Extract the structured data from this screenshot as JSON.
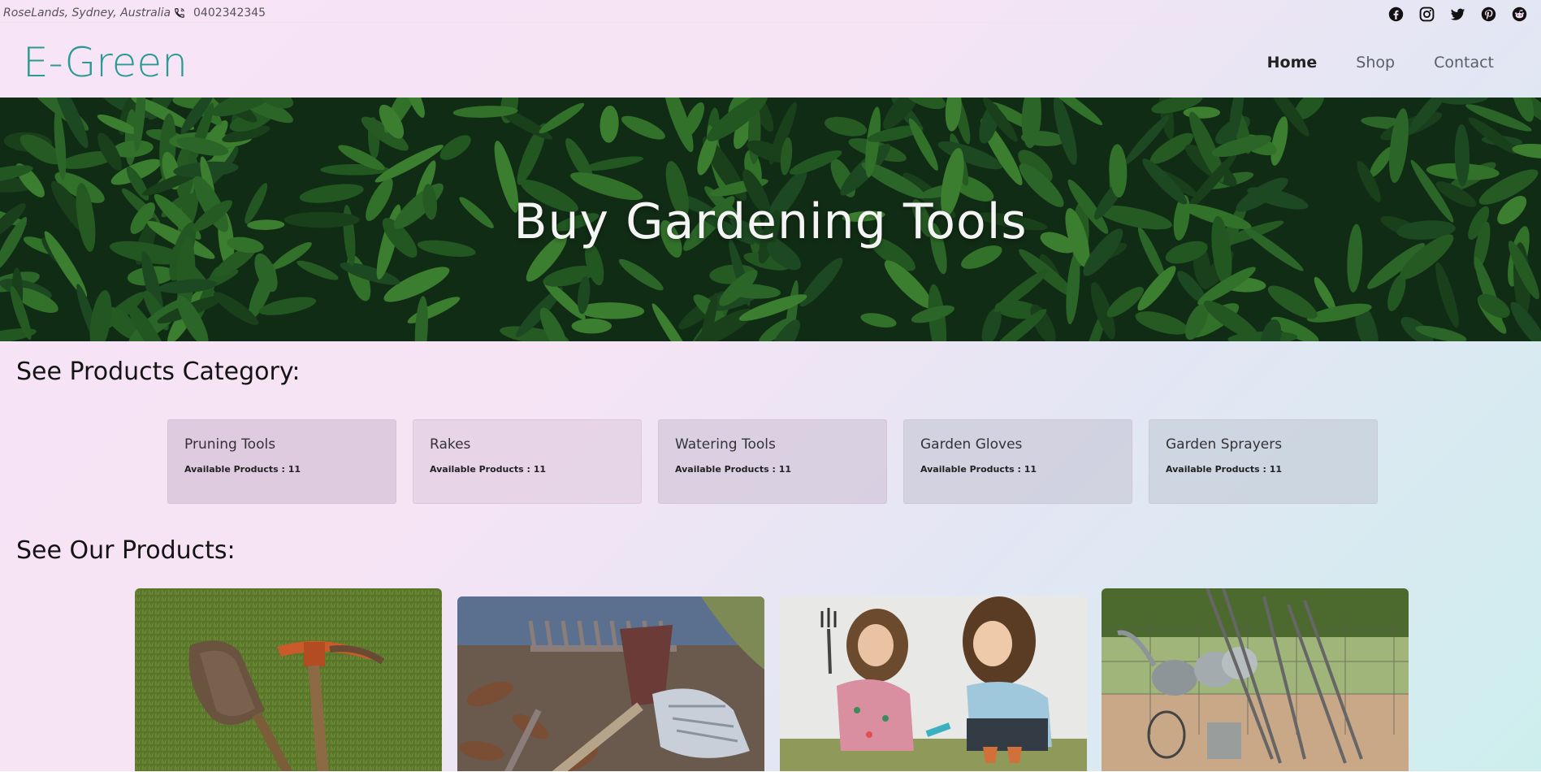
{
  "topbar": {
    "address": "RoseLands, Sydney, Australia",
    "phone": "0402342345",
    "social": [
      "facebook-icon",
      "instagram-icon",
      "twitter-icon",
      "pinterest-icon",
      "reddit-icon"
    ]
  },
  "header": {
    "logo": "E-Green",
    "nav": [
      {
        "label": "Home",
        "active": true
      },
      {
        "label": "Shop",
        "active": false
      },
      {
        "label": "Contact",
        "active": false
      }
    ]
  },
  "hero": {
    "title": "Buy Gardening Tools"
  },
  "categories_section": {
    "title": "See Products Category:",
    "items": [
      {
        "name": "Pruning Tools",
        "count": "Available Products : 11"
      },
      {
        "name": "Rakes",
        "count": "Available Products : 11"
      },
      {
        "name": "Watering Tools",
        "count": "Available Products : 11"
      },
      {
        "name": "Garden Gloves",
        "count": "Available Products : 11"
      },
      {
        "name": "Garden Sprayers",
        "count": "Available Products : 11"
      }
    ]
  },
  "products_section": {
    "title": "See Our Products:"
  },
  "colors": {
    "logo": "#2a9a93",
    "page_gradient_start": "#f7e4f6",
    "page_gradient_end": "#cdeeee",
    "hero_leaves": "#2f7a2a"
  }
}
